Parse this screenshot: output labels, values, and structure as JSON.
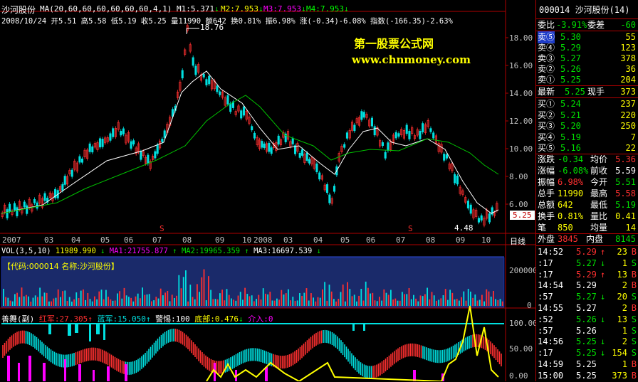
{
  "colors": {
    "up": "#ff3030",
    "down": "#00e0e0",
    "yellow": "#ffff00",
    "magenta": "#ff00ff",
    "green": "#00c000",
    "white": "#ffffff",
    "grid": "#b00000",
    "blue": "#2040ff"
  },
  "header": {
    "stock_name": "沙河股份",
    "ma_label": "MA(20,60,60,60,60,60,60,4,1)",
    "m1": "M1:5.371",
    "m2": "M2:7.953",
    "m3": "M3:7.953",
    "m4": "M4:7.953",
    "m1_arrow": "↓",
    "m2_arrow": "↓",
    "m3_arrow": "↓",
    "m4_arrow": "↓",
    "quote_line": "2008/10/24 开5.51 高5.58 低5.19 收5.25 量11990 额642 换0.81% 振6.98% 涨(-0.34)-6.08% 指数(-166.35)-2.63%"
  },
  "watermark": {
    "line1": "第一股票公式网",
    "line2": "www.chnmoney.com"
  },
  "main_chart": {
    "high_label": "18.76",
    "low_label": "4.48",
    "price_tag": "5.25",
    "marker": "S",
    "y_ticks": [
      "18.00",
      "16.00",
      "14.00",
      "12.00",
      "10.00",
      "8.00",
      "6.00"
    ],
    "x_labels": [
      "2007",
      "03",
      "04",
      "05",
      "06",
      "07",
      "08",
      "09",
      "10",
      "2008",
      "03",
      "04",
      "05",
      "06",
      "07",
      "08",
      "09",
      "10"
    ],
    "period": "日线"
  },
  "volume": {
    "label": "VOL(3,5,10)",
    "value": "11989.990",
    "ma1": "MA1:21755.877",
    "ma2": "MA2:19965.359",
    "ma3": "MA3:16697.539",
    "code_label": "【代码:000014 名称:沙河股份】",
    "y_ticks": [
      "200000",
      "0"
    ]
  },
  "indicator": {
    "name": "善舞(副)",
    "red": "红军:27.305",
    "blue": "蓝军:15.050",
    "alert": "警惕:100",
    "bottom": "底部:0.476",
    "entry": "介入:0",
    "y_ticks": [
      "100.00",
      "50.00",
      "0.00"
    ]
  },
  "sidebar": {
    "title": "000014 沙河股份(14)",
    "wei_bi": "委比",
    "wei_bi_val": "-3.91%",
    "wei_cha": "委差",
    "wei_cha_val": "-60",
    "asks": [
      {
        "label": "卖⑤",
        "price": "5.30",
        "vol": "55"
      },
      {
        "label": "卖④",
        "price": "5.29",
        "vol": "123"
      },
      {
        "label": "卖③",
        "price": "5.27",
        "vol": "378"
      },
      {
        "label": "卖②",
        "price": "5.26",
        "vol": "36"
      },
      {
        "label": "卖①",
        "price": "5.25",
        "vol": "204"
      }
    ],
    "latest_label": "最新",
    "latest": "5.25",
    "now_hand_label": "现手",
    "now_hand": "373",
    "bids": [
      {
        "label": "买①",
        "price": "5.24",
        "vol": "237"
      },
      {
        "label": "买②",
        "price": "5.21",
        "vol": "220"
      },
      {
        "label": "买③",
        "price": "5.20",
        "vol": "250"
      },
      {
        "label": "买④",
        "price": "5.19",
        "vol": "7"
      },
      {
        "label": "买⑤",
        "price": "5.16",
        "vol": "22"
      }
    ],
    "stats": [
      {
        "l1": "涨跌",
        "v1": "-0.34",
        "l2": "均价",
        "v2": "5.36"
      },
      {
        "l1": "涨幅",
        "v1": "-6.08%",
        "l2": "前收",
        "v2": "5.59"
      },
      {
        "l1": "振幅",
        "v1": "6.98%",
        "l2": "今开",
        "v2": "5.51"
      },
      {
        "l1": "总手",
        "v1": "11990",
        "l2": "最高",
        "v2": "5.58"
      },
      {
        "l1": "总额",
        "v1": "642",
        "l2": "最低",
        "v2": "5.19"
      },
      {
        "l1": "换手",
        "v1": "0.81%",
        "l2": "量比",
        "v2": "0.41"
      },
      {
        "l1": "笔",
        "v1": "850",
        "l2": "均量",
        "v2": "14"
      }
    ],
    "outer_label": "外盘",
    "outer": "3845",
    "inner_label": "内盘",
    "inner": "8145",
    "ticks": [
      {
        "t": "14:52",
        "p": "5.29",
        "a": "↑",
        "v": "23",
        "s": "B"
      },
      {
        "t": ":17",
        "p": "5.27",
        "a": "↓",
        "v": "1",
        "s": "S"
      },
      {
        "t": ":17",
        "p": "5.29",
        "a": "↑",
        "v": "13",
        "s": "B"
      },
      {
        "t": "14:54",
        "p": "5.29",
        "a": "",
        "v": "2",
        "s": "B"
      },
      {
        "t": ":57",
        "p": "5.27",
        "a": "↓",
        "v": "20",
        "s": "S"
      },
      {
        "t": "14:55",
        "p": "5.27",
        "a": "",
        "v": "2",
        "s": "B"
      },
      {
        "t": ":52",
        "p": "5.26",
        "a": "↓",
        "v": "13",
        "s": "S"
      },
      {
        "t": ":57",
        "p": "5.26",
        "a": "",
        "v": "1",
        "s": "S"
      },
      {
        "t": "14:56",
        "p": "5.25",
        "a": "↓",
        "v": "2",
        "s": "S"
      },
      {
        "t": ":17",
        "p": "5.25",
        "a": "↓",
        "v": "154",
        "s": "S"
      },
      {
        "t": "14:59",
        "p": "5.25",
        "a": "",
        "v": "1",
        "s": "B"
      },
      {
        "t": "15:00",
        "p": "5.25",
        "a": "",
        "v": "373",
        "s": "B"
      }
    ]
  }
}
